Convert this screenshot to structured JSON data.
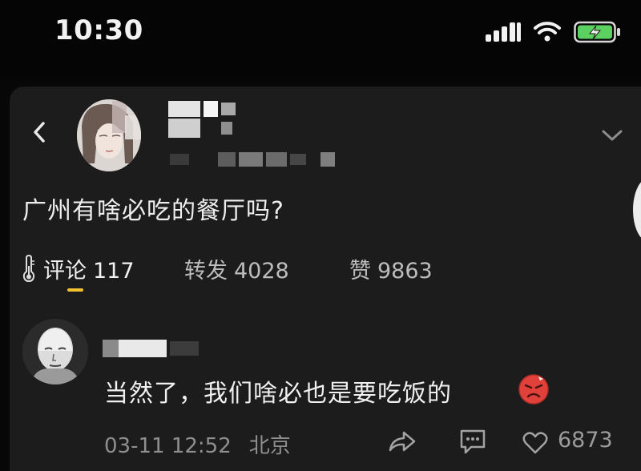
{
  "status_bar": {
    "time": "10:30"
  },
  "post": {
    "title": "广州有啥必吃的餐厅吗?",
    "stats": {
      "comments_label": "评论",
      "comments_count": "117",
      "reposts_label": "转发",
      "reposts_count": "4028",
      "likes_label": "赞",
      "likes_count": "9863"
    }
  },
  "comment": {
    "text": "当然了，我们啥必也是要吃饭的",
    "date": "03-11 12:52",
    "location": "北京",
    "like_count": "6873"
  },
  "colors": {
    "background": "#070707",
    "card": "#1c1c1c",
    "active_tab_underline": "#f1c232",
    "emoji": "#e0413a"
  },
  "icons": [
    "signal-icon",
    "wifi-icon",
    "battery-charging-icon",
    "back-icon",
    "chevron-down-icon",
    "thermometer-icon",
    "share-icon",
    "reply-icon",
    "heart-icon",
    "angry-emoji-icon"
  ]
}
